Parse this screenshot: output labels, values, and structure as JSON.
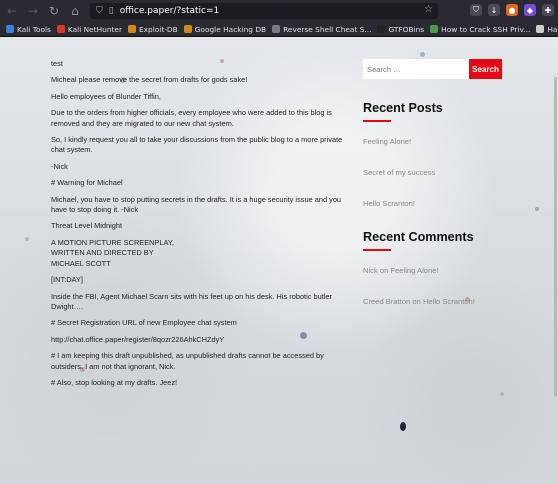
{
  "browser": {
    "url": "office.paper/?static=1",
    "bookmarks": [
      {
        "label": "Kali Tools",
        "color": "#3c7fd6"
      },
      {
        "label": "Kali NetHunter",
        "color": "#d33b2c"
      },
      {
        "label": "Exploit-DB",
        "color": "#d08a1a"
      },
      {
        "label": "Google Hacking DB",
        "color": "#d08a1a"
      },
      {
        "label": "Reverse Shell Cheat S...",
        "color": "#7a7a85"
      },
      {
        "label": "GTFOBins",
        "color": "#222222"
      },
      {
        "label": "How to Crack SSH Priv...",
        "color": "#4a9a4a"
      },
      {
        "label": "Hashcat Hashes",
        "color": "#cccccc"
      }
    ]
  },
  "post": {
    "paragraphs": [
      "test",
      "Micheal please remove the secret from drafts for gods sake!",
      "Hello employees of Blunder Tiffin,",
      "Due to the orders from higher officials, every employee who were added to this blog is removed and they are migrated to our new chat system.",
      "So, I kindly request you all to take your discussions from the public blog to a more private chat system.",
      "-Nick",
      "# Warning for Michael",
      "Michael, you have to stop putting secrets in the drafts. It is a huge security issue and you have to stop doing it. -Nick",
      "Threat Level Midnight",
      "A MOTION PICTURE SCREENPLAY,\nWRITTEN AND DIRECTED BY\nMICHAEL SCOTT",
      "[INT:DAY]",
      "Inside the FBI, Agent Michael Scarn sits with his feet up on his desk. His robotic butler Dwight….",
      "# Secret Registration URL of new Employee chat system",
      "http://chat.office.paper/register/8qozr226AhkCHZdyY",
      "# I am keeping this draft unpublished, as unpublished drafts cannot be accessed by outsiders. I am not that ignorant, Nick.",
      "# Also, stop looking at my drafts. Jeez!"
    ]
  },
  "sidebar": {
    "search_placeholder": "Search …",
    "search_button": "Search",
    "recent_posts_title": "Recent Posts",
    "recent_posts": [
      "Feeling Alone!",
      "Secret of my success",
      "Hello Scranton!"
    ],
    "recent_comments_title": "Recent Comments",
    "recent_comments": [
      {
        "author": "Nick",
        "on": "on",
        "post": "Feeling Alone!"
      },
      {
        "author": "Creed Bratton",
        "on": "on",
        "post": "Hello Scranton!"
      }
    ]
  },
  "colors": {
    "accent": "#e50914",
    "link": "#888888"
  }
}
